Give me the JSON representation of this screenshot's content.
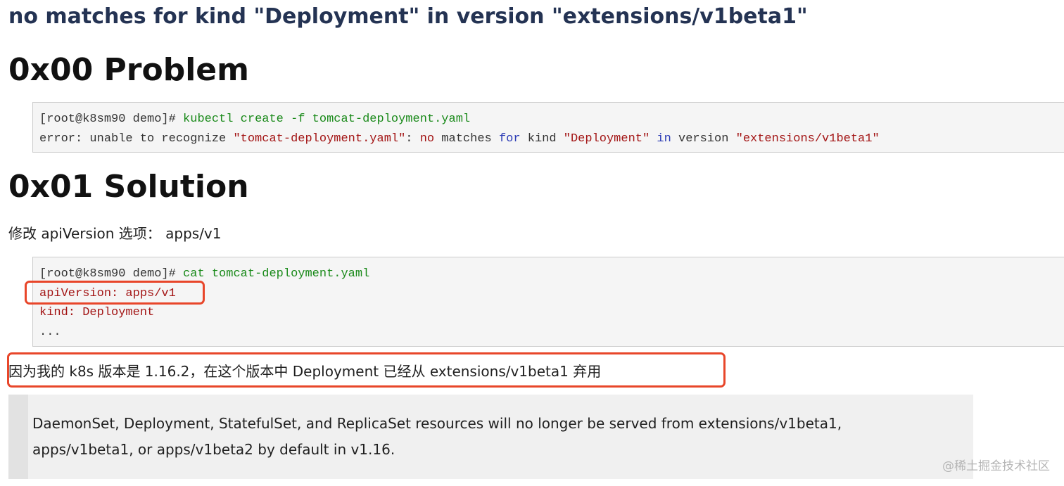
{
  "title": "no matches for kind \"Deployment\" in version \"extensions/v1beta1\"",
  "problem": {
    "heading": "0x00 Problem",
    "code": {
      "line1": {
        "prompt": "[root@k8sm90 demo]#",
        "command": "kubectl create -f tomcat-deployment.yaml"
      },
      "line2": {
        "p1": "error: unable to recognize ",
        "s1": "\"tomcat-deployment.yaml\"",
        "p2": ": ",
        "k_no": "no",
        "p3": " matches ",
        "k_for": "for",
        "p4": " kind ",
        "s2": "\"Deployment\"",
        "p5": " ",
        "k_in": "in",
        "p6": " version ",
        "s3": "\"extensions/v1beta1\""
      }
    }
  },
  "solution": {
    "heading": "0x01 Solution",
    "modify_text": "修改 apiVersion 选项： apps/v1",
    "code": {
      "prompt": "[root@k8sm90 demo]#",
      "command": "cat tomcat-deployment.yaml",
      "line_api": "apiVersion: apps/v1",
      "line_kind": "kind: Deployment",
      "line_more": "..."
    },
    "reason_text": "因为我的 k8s 版本是 1.16.2，在这个版本中 Deployment 已经从 extensions/v1beta1 弃用",
    "quote": {
      "line1": "DaemonSet, Deployment, StatefulSet, and ReplicaSet resources will no longer be served from extensions/v1beta1,",
      "line2": "apps/v1beta1, or apps/v1beta2 by default in v1.16."
    }
  },
  "watermark": "@稀土掘金技术社区",
  "colors": {
    "title": "#243353",
    "highlight": "#e8462a",
    "code_command": "#1a8a1a",
    "code_string": "#a31515",
    "code_keyword": "#2b3bb5"
  }
}
